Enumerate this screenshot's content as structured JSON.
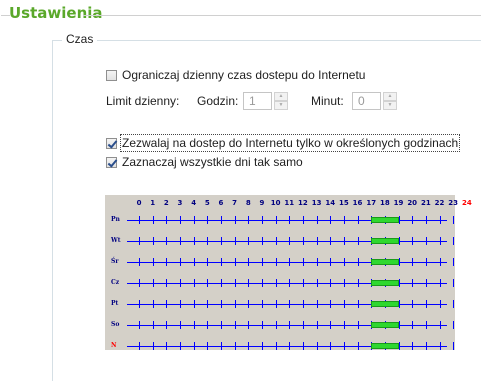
{
  "section": {
    "title": "Ustawienia"
  },
  "group": {
    "title": "Czas"
  },
  "limit_daily": {
    "label": "Ograniczaj dzienny czas dostepu do Internetu",
    "checked": false
  },
  "limit_row": {
    "label": "Limit dzienny:",
    "hours_label": "Godzin:",
    "hours_value": "1",
    "minutes_label": "Minut:",
    "minutes_value": "0"
  },
  "allow_hours": {
    "label": "Zezwalaj na dostep do Internetu tylko w określonych godzinach",
    "checked": true
  },
  "same_days": {
    "label": "Zaznaczaj wszystkie dni tak samo",
    "checked": true
  },
  "schedule": {
    "hours": [
      "0",
      "1",
      "2",
      "3",
      "4",
      "5",
      "6",
      "7",
      "8",
      "9",
      "10",
      "11",
      "12",
      "13",
      "14",
      "15",
      "16",
      "17",
      "18",
      "19",
      "20",
      "21",
      "22",
      "23",
      "24"
    ],
    "days": [
      {
        "label": "Pn",
        "color": "#000080"
      },
      {
        "label": "Wt",
        "color": "#000080"
      },
      {
        "label": "Śr",
        "color": "#000080"
      },
      {
        "label": "Cz",
        "color": "#000080"
      },
      {
        "label": "Pt",
        "color": "#000080"
      },
      {
        "label": "So",
        "color": "#000080"
      },
      {
        "label": "N",
        "color": "#ff0000"
      }
    ],
    "allowed_from": 17,
    "allowed_to": 19,
    "colors": {
      "grid": "#0000ff",
      "allowed": "#2fd82f",
      "background": "#d4d0c8",
      "weekend": "#ff0000"
    }
  },
  "icons": {
    "spin_up": "spin-up-icon",
    "spin_down": "spin-down-icon"
  }
}
